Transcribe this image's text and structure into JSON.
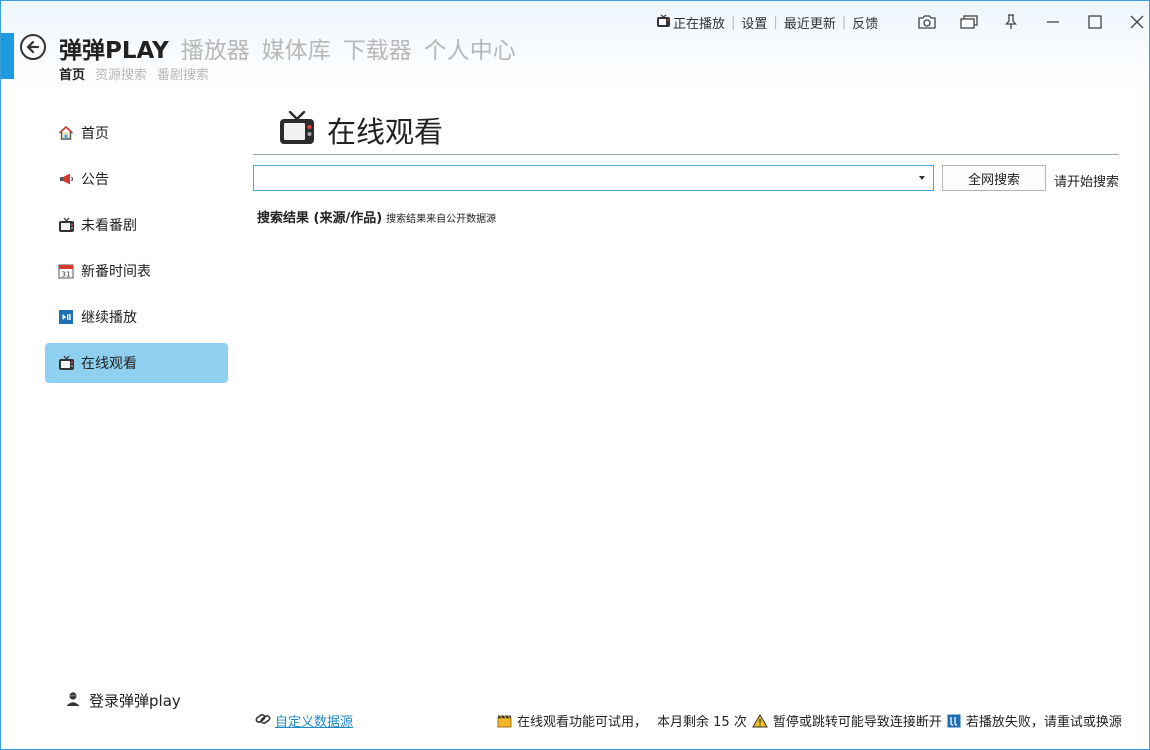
{
  "nav": {
    "brand": "弹弹PLAY",
    "tabs": [
      "播放器",
      "媒体库",
      "下载器",
      "个人中心"
    ],
    "sub_tabs": [
      "首页",
      "资源搜索",
      "番剧搜索"
    ]
  },
  "top_links": {
    "now_playing": "正在播放",
    "settings": "设置",
    "recent_updates": "最近更新",
    "feedback": "反馈"
  },
  "sidebar": {
    "items": [
      {
        "label": "首页",
        "icon": "home-icon"
      },
      {
        "label": "公告",
        "icon": "megaphone-icon"
      },
      {
        "label": "未看番剧",
        "icon": "tv-icon"
      },
      {
        "label": "新番时间表",
        "icon": "calendar-icon"
      },
      {
        "label": "继续播放",
        "icon": "play-pause-icon"
      },
      {
        "label": "在线观看",
        "icon": "tv-icon"
      }
    ],
    "active_index": 5,
    "login": "登录弹弹play"
  },
  "main": {
    "title": "在线观看",
    "search_value": "",
    "search_button": "全网搜索",
    "search_hint": "请开始搜索",
    "results_title": "搜索结果 (来源/作品)",
    "results_note": "搜索结果来自公开数据源"
  },
  "footer": {
    "custom_source": "自定义数据源",
    "trial_notice": "在线观看功能可试用，",
    "remaining": "本月剩余 15 次",
    "warning": "暂停或跳转可能导致连接断开",
    "retry_tip": "若播放失败，请重试或换源"
  },
  "colors": {
    "accent": "#1e9ae0",
    "active_sidebar": "#8fd0f0",
    "link": "#1e88c8"
  }
}
